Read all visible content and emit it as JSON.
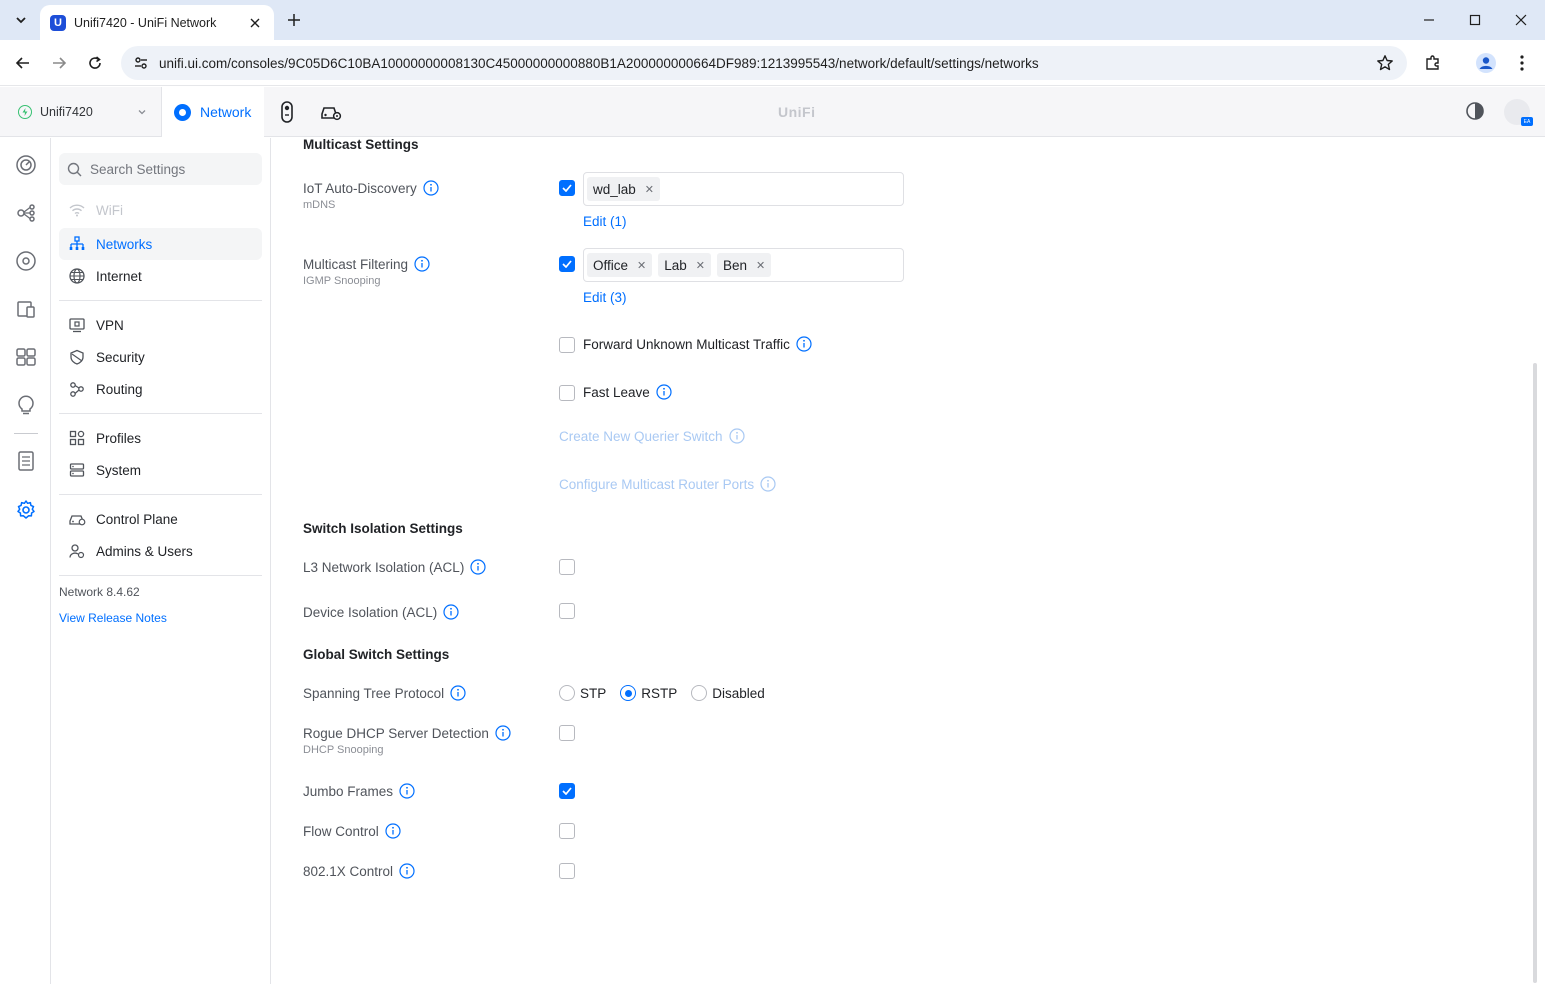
{
  "browser": {
    "tab_title": "Unifi7420 - UniFi Network",
    "url": "unifi.ui.com/consoles/9C05D6C10BA10000000008130C45000000000880B1A200000000664DF989:1213995543/network/default/settings/networks"
  },
  "header": {
    "console_name": "Unifi7420",
    "active_app": "Network",
    "brand": "UniFi",
    "avatar_badge": "EA"
  },
  "sidebar": {
    "search_placeholder": "Search Settings",
    "items": [
      {
        "label": "WiFi"
      },
      {
        "label": "Networks"
      },
      {
        "label": "Internet"
      },
      {
        "label": "VPN"
      },
      {
        "label": "Security"
      },
      {
        "label": "Routing"
      },
      {
        "label": "Profiles"
      },
      {
        "label": "System"
      },
      {
        "label": "Control Plane"
      },
      {
        "label": "Admins & Users"
      }
    ],
    "version": "Network 8.4.62",
    "release_notes": "View Release Notes"
  },
  "multicast": {
    "title": "Multicast Settings",
    "iot_label": "IoT Auto-Discovery",
    "iot_sub": "mDNS",
    "iot_checked": true,
    "iot_tags": [
      "wd_lab"
    ],
    "iot_edit": "Edit (1)",
    "filter_label": "Multicast Filtering",
    "filter_sub": "IGMP Snooping",
    "filter_checked": true,
    "filter_tags": [
      "Office",
      "Lab",
      "Ben"
    ],
    "filter_edit": "Edit (3)",
    "forward_unknown": "Forward Unknown Multicast Traffic",
    "fast_leave": "Fast Leave",
    "create_querier": "Create New Querier Switch",
    "configure_router_ports": "Configure Multicast Router Ports"
  },
  "isolation": {
    "title": "Switch Isolation Settings",
    "l3_label": "L3 Network Isolation (ACL)",
    "device_label": "Device Isolation (ACL)"
  },
  "global": {
    "title": "Global Switch Settings",
    "stp_label": "Spanning Tree Protocol",
    "stp_options": [
      "STP",
      "RSTP",
      "Disabled"
    ],
    "stp_selected": "RSTP",
    "rogue_label": "Rogue DHCP Server Detection",
    "rogue_sub": "DHCP Snooping",
    "jumbo_label": "Jumbo Frames",
    "jumbo_checked": true,
    "flow_label": "Flow Control",
    "dot1x_label": "802.1X Control"
  },
  "colors": {
    "accent": "#006fff",
    "disabled_link": "#a9c9f3",
    "status_online": "#38c172"
  }
}
